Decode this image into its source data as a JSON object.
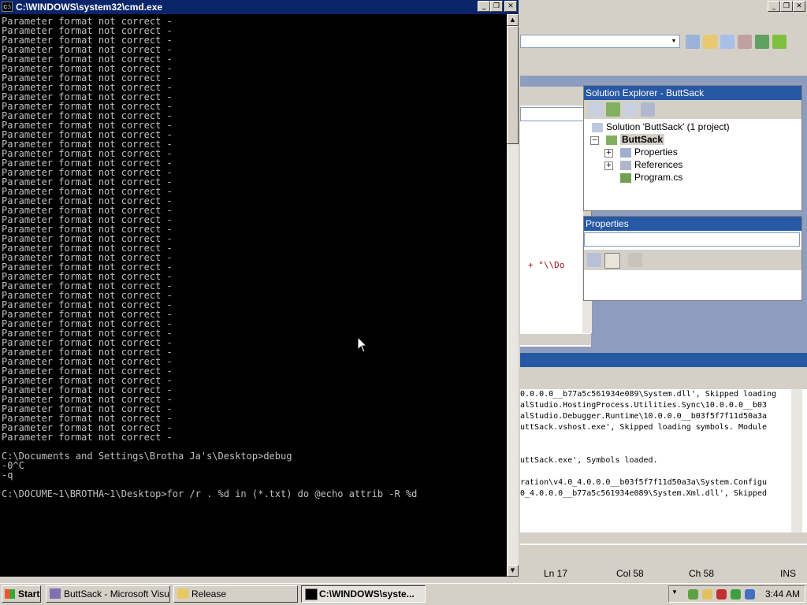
{
  "cmd": {
    "title": "C:\\WINDOWS\\system32\\cmd.exe",
    "icon": "cmd-icon",
    "error_line": "Parameter format not correct -",
    "error_count": 45,
    "tail_lines": [
      "",
      "C:\\Documents and Settings\\Brotha Ja's\\Desktop>debug",
      "-0^C",
      "-q",
      "",
      "C:\\DOCUME~1\\BROTHA~1\\Desktop>for /r . %d in (*.txt) do @echo attrib -R %d"
    ]
  },
  "solution_explorer": {
    "title": "Solution Explorer - ButtSack",
    "solution_label": "Solution 'ButtSack' (1 project)",
    "project_label": "ButtSack",
    "items": [
      {
        "label": "Properties"
      },
      {
        "label": "References"
      },
      {
        "label": "Program.cs"
      }
    ]
  },
  "properties": {
    "title": "Properties"
  },
  "editor": {
    "code_fragment": "+ \"\\\\Do"
  },
  "output": {
    "lines": [
      "0.0.0.0__b77a5c561934e089\\System.dll', Skipped loading",
      "alStudio.HostingProcess.Utilities.Sync\\10.0.0.0__b03",
      "alStudio.Debugger.Runtime\\10.0.0.0__b03f5f7f11d50a3a",
      "uttSack.vshost.exe', Skipped loading symbols. Module",
      "",
      "",
      "uttSack.exe', Symbols loaded.",
      "",
      "ration\\v4.0_4.0.0.0__b03f5f7f11d50a3a\\System.Configu",
      "0_4.0.0.0__b77a5c561934e089\\System.Xml.dll', Skipped"
    ]
  },
  "statusbar": {
    "ln": "Ln 17",
    "col": "Col 58",
    "ch": "Ch 58",
    "ins": "INS"
  },
  "taskbar": {
    "start_label": "Start",
    "tasks": [
      {
        "label": "ButtSack - Microsoft Visu..."
      },
      {
        "label": "Release"
      },
      {
        "label": "C:\\WINDOWS\\syste..."
      }
    ],
    "clock": "3:44 AM"
  },
  "colors": {
    "console_bg": "#000000",
    "console_fg": "#c0c0c0",
    "active_title": "#0a246a",
    "pane_title": "#2758a4"
  }
}
